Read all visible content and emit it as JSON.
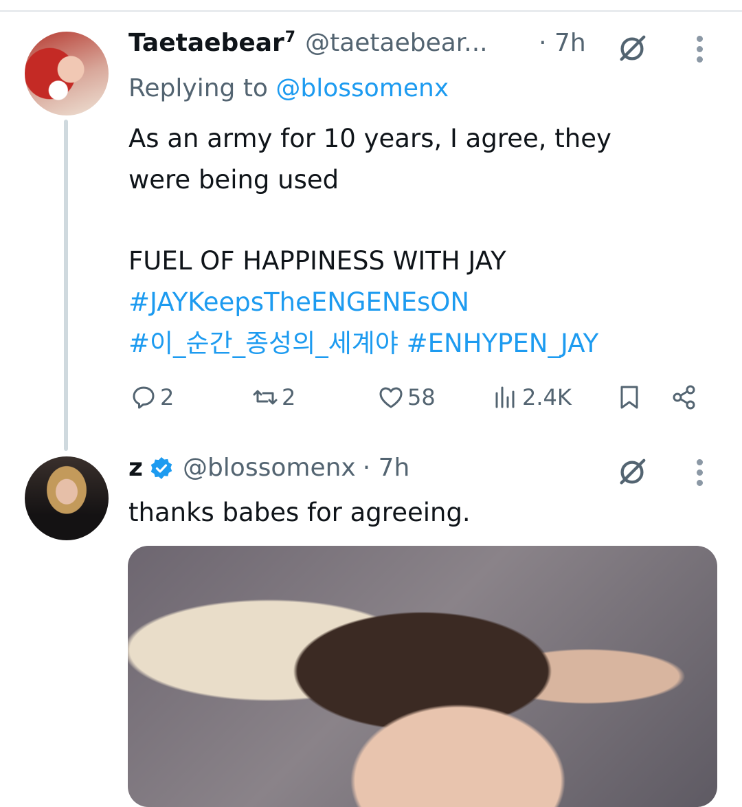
{
  "tweet1": {
    "display_name": "Taetaebear",
    "name_badge": "7",
    "handle": "@taetaebear...",
    "time": "· 7h",
    "reply_prefix": "Replying to ",
    "reply_mention": "@blossomenx",
    "text_line1": "As an army for 10 years, I agree, they",
    "text_line2": "were being used",
    "text_line3": "FUEL OF HAPPINESS WITH JAY",
    "hashtags_line1": "#JAYKeepsTheENGENEsON",
    "hashtags_line2": "#이_순간_종성의_세계야 #ENHYPEN_JAY",
    "actions": {
      "replies": "2",
      "retweets": "2",
      "likes": "58",
      "views": "2.4K"
    }
  },
  "tweet2": {
    "display_name": "z",
    "verified": true,
    "handle": "@blossomenx",
    "time": "· 7h",
    "text": "thanks babes for agreeing."
  },
  "colors": {
    "link": "#1d9bf0",
    "secondary_text": "#536471",
    "thread_line": "#cfd9de"
  }
}
